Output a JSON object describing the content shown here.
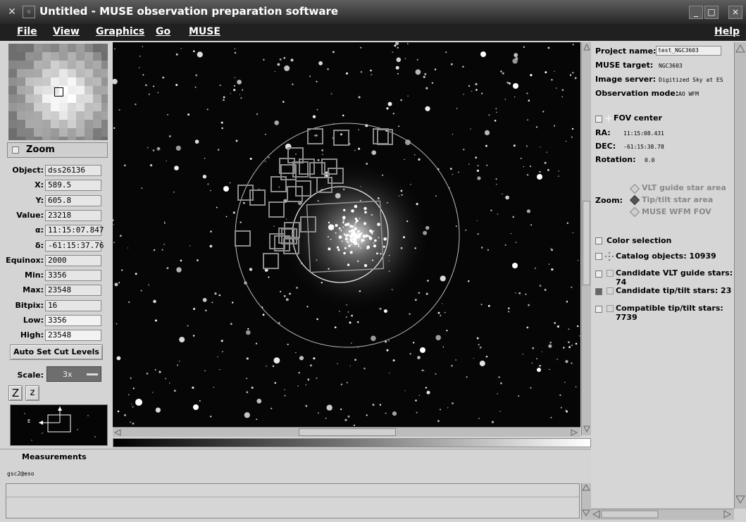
{
  "window": {
    "title": "Untitled - MUSE observation preparation software",
    "close_icon": "close-icon",
    "minimize_label": "_",
    "maximize_label": "□",
    "close_label": "×"
  },
  "menu": {
    "file": "File",
    "view": "View",
    "graphics": "Graphics",
    "go": "Go",
    "muse": "MUSE",
    "help": "Help"
  },
  "left": {
    "zoom_label": "Zoom",
    "fields": [
      {
        "label": "Object:",
        "value": "dss26136"
      },
      {
        "label": "X:",
        "value": "589.5"
      },
      {
        "label": "Y:",
        "value": "605.8"
      },
      {
        "label": "Value:",
        "value": "23218"
      },
      {
        "label": "α:",
        "value": "11:15:07.847"
      },
      {
        "label": "δ:",
        "value": "-61:15:37.76"
      },
      {
        "label": "Equinox:",
        "value": "2000"
      },
      {
        "label": "Min:",
        "value": "3356"
      },
      {
        "label": "Max:",
        "value": "23548"
      },
      {
        "label": "Bitpix:",
        "value": "16"
      },
      {
        "label": "Low:",
        "value": "3356"
      },
      {
        "label": "High:",
        "value": "23548"
      }
    ],
    "auto_cut_button": "Auto Set Cut Levels",
    "scale_label": "Scale:",
    "scale_value": "3x",
    "zoom_in_label": "Z",
    "zoom_out_label": "z",
    "compass_east": "E",
    "measurements": "Measurements",
    "status": "gsc2@eso"
  },
  "right": {
    "project_label": "Project name:",
    "project_value": "test_NGC3603",
    "target_label": "MUSE target:",
    "target_value": "NGC3603",
    "server_label": "Image server:",
    "server_value": "Digitized Sky at ES",
    "mode_label": "Observation mode:",
    "mode_value": "AO WFM",
    "fov_center": "FOV center",
    "ra_label": "RA:",
    "ra_value": "11:15:08.431",
    "dec_label": "DEC:",
    "dec_value": "-61:15:38.78",
    "rotation_label": "Rotation:",
    "rotation_value": "0.0",
    "zoom_label": "Zoom:",
    "zoom_options": [
      "VLT guide star area",
      "Tip/tilt star area",
      "MUSE WFM FOV"
    ],
    "color_selection": "Color selection",
    "catalog_objects": "Catalog objects: 10939",
    "vlt_guide": "Candidate VLT guide stars: 74",
    "tiptilt_candidates": "Candidate tip/tilt stars: 23",
    "tiptilt_compatible": "Compatible tip/tilt stars: 7739"
  }
}
